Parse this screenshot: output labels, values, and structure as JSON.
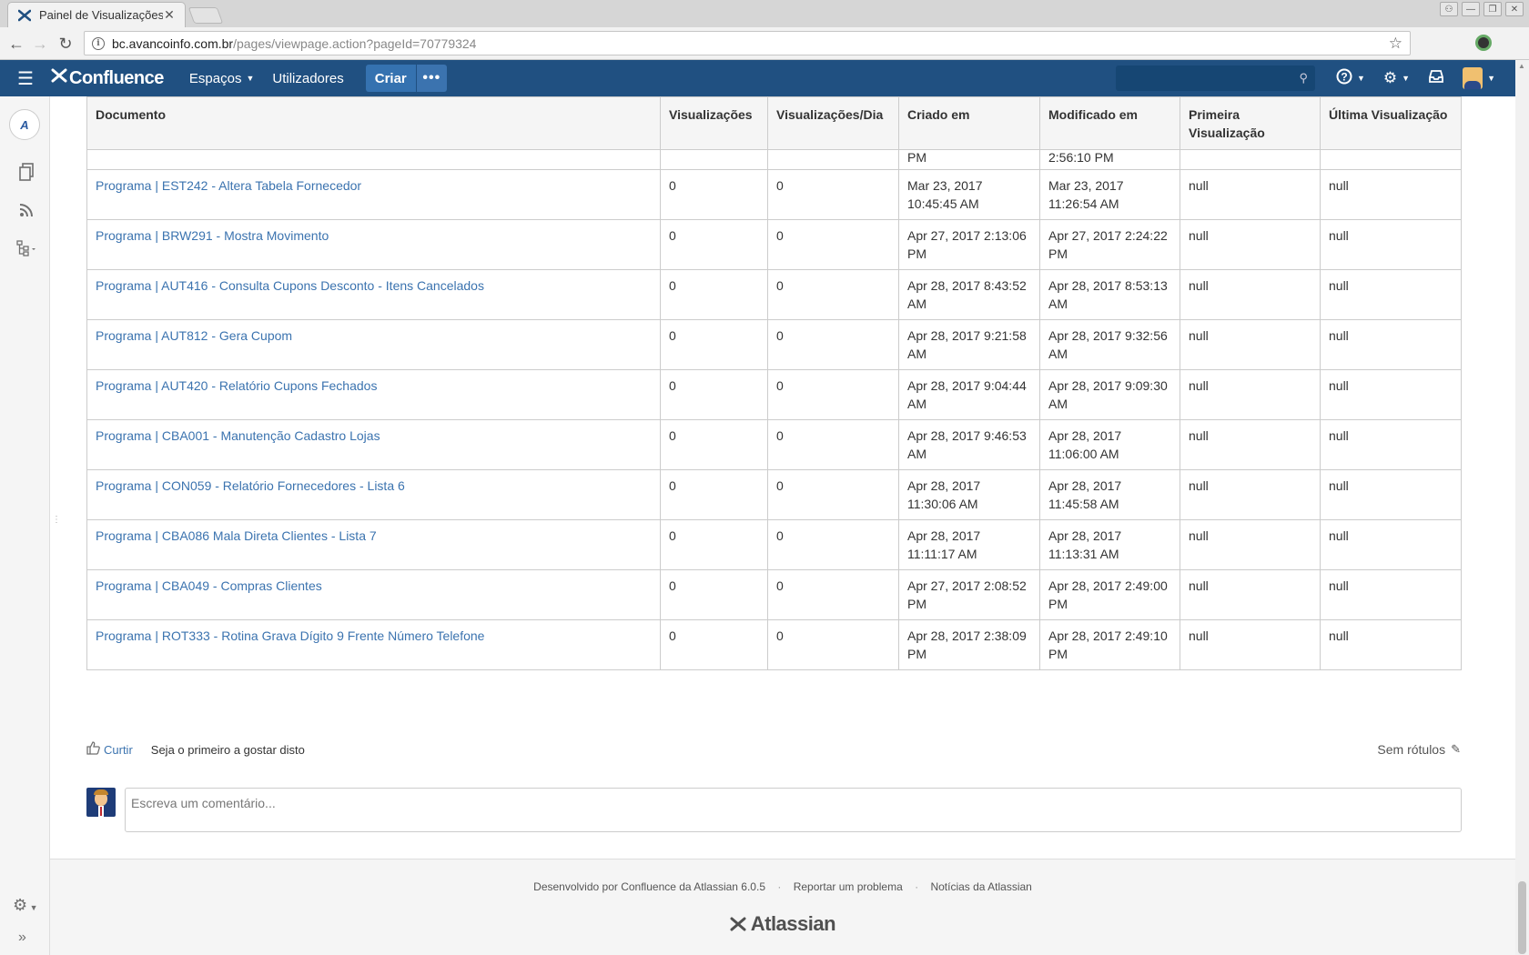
{
  "browser": {
    "tab_title": "Painel de Visualizações",
    "url_host": "bc.avancoinfo.com.br",
    "url_path": "/pages/viewpage.action?pageId=70779324"
  },
  "header": {
    "logo": "Confluence",
    "spaces": "Espaços",
    "users": "Utilizadores",
    "create": "Criar",
    "more": "•••"
  },
  "sidebar": {
    "space_logo": "A"
  },
  "table": {
    "columns": [
      "Documento",
      "Visualizações",
      "Visualizações/Dia",
      "Criado em",
      "Modificado em",
      "Primeira Visualização",
      "Última Visualização"
    ],
    "partial_row": {
      "created": "PM",
      "modified": "2:56:10 PM"
    },
    "rows": [
      {
        "doc": "Programa | EST242 - Altera Tabela Fornecedor",
        "views": "0",
        "per_day": "0",
        "created": "Mar 23, 2017 10:45:45 AM",
        "modified": "Mar 23, 2017 11:26:54 AM",
        "first": "null",
        "last": "null"
      },
      {
        "doc": "Programa | BRW291 - Mostra Movimento",
        "views": "0",
        "per_day": "0",
        "created": "Apr 27, 2017 2:13:06 PM",
        "modified": "Apr 27, 2017 2:24:22 PM",
        "first": "null",
        "last": "null"
      },
      {
        "doc": "Programa | AUT416 - Consulta Cupons Desconto - Itens Cancelados",
        "views": "0",
        "per_day": "0",
        "created": "Apr 28, 2017 8:43:52 AM",
        "modified": "Apr 28, 2017 8:53:13 AM",
        "first": "null",
        "last": "null"
      },
      {
        "doc": "Programa | AUT812 - Gera Cupom",
        "views": "0",
        "per_day": "0",
        "created": "Apr 28, 2017 9:21:58 AM",
        "modified": "Apr 28, 2017 9:32:56 AM",
        "first": "null",
        "last": "null"
      },
      {
        "doc": "Programa | AUT420 - Relatório Cupons Fechados",
        "views": "0",
        "per_day": "0",
        "created": "Apr 28, 2017 9:04:44 AM",
        "modified": "Apr 28, 2017 9:09:30 AM",
        "first": "null",
        "last": "null"
      },
      {
        "doc": "Programa | CBA001 - Manutenção Cadastro Lojas",
        "views": "0",
        "per_day": "0",
        "created": "Apr 28, 2017 9:46:53 AM",
        "modified": "Apr 28, 2017 11:06:00 AM",
        "first": "null",
        "last": "null"
      },
      {
        "doc": "Programa | CON059 - Relatório Fornecedores - Lista 6",
        "views": "0",
        "per_day": "0",
        "created": "Apr 28, 2017 11:30:06 AM",
        "modified": "Apr 28, 2017 11:45:58 AM",
        "first": "null",
        "last": "null"
      },
      {
        "doc": "Programa | CBA086 Mala Direta Clientes - Lista 7",
        "views": "0",
        "per_day": "0",
        "created": "Apr 28, 2017 11:11:17 AM",
        "modified": "Apr 28, 2017 11:13:31 AM",
        "first": "null",
        "last": "null"
      },
      {
        "doc": "Programa | CBA049 - Compras Clientes",
        "views": "0",
        "per_day": "0",
        "created": "Apr 27, 2017 2:08:52 PM",
        "modified": "Apr 28, 2017 2:49:00 PM",
        "first": "null",
        "last": "null"
      },
      {
        "doc": "Programa | ROT333 - Rotina Grava Dígito 9 Frente Número Telefone",
        "views": "0",
        "per_day": "0",
        "created": "Apr 28, 2017 2:38:09 PM",
        "modified": "Apr 28, 2017 2:49:10 PM",
        "first": "null",
        "last": "null"
      }
    ]
  },
  "likes": {
    "like_label": "Curtir",
    "like_text": "Seja o primeiro a gostar disto"
  },
  "labels": {
    "text": "Sem rótulos"
  },
  "comment": {
    "placeholder": "Escreva um comentário..."
  },
  "footer": {
    "powered": "Desenvolvido por Confluence da Atlassian 6.0.5",
    "report": "Reportar um problema",
    "news": "Notícias da Atlassian",
    "sep": "·",
    "brand": "Atlassian"
  },
  "colors": {
    "header_bg": "#205081",
    "link": "#3b73af",
    "create_btn": "#3572b0"
  }
}
